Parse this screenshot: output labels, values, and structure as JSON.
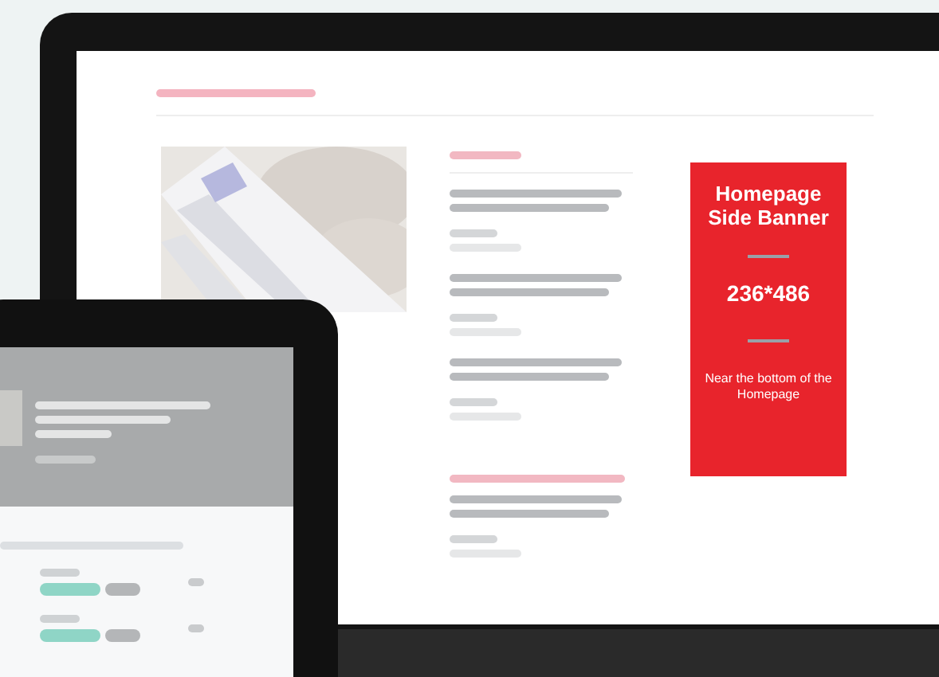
{
  "ad_banner": {
    "title": "Homepage Side Banner",
    "size": "236*486",
    "note": "Near the bottom of the Homepage"
  }
}
